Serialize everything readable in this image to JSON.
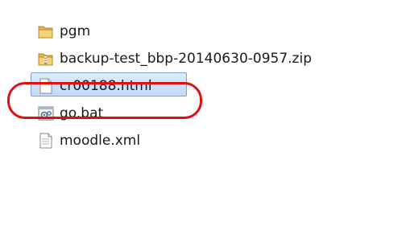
{
  "files": [
    {
      "name": "pgm",
      "icon": "folder-icon"
    },
    {
      "name": "backup-test_bbp-20140630-0957.zip",
      "icon": "zip-folder-icon"
    },
    {
      "name": "cr00188.html",
      "icon": "html-file-icon"
    },
    {
      "name": "go.bat",
      "icon": "batch-file-icon"
    },
    {
      "name": "moodle.xml",
      "icon": "xml-file-icon"
    }
  ],
  "selected_file": "cr00188.html",
  "colors": {
    "highlight_ring": "#e01010",
    "selection_border": "#7da2ce",
    "selection_fill": "#c1dbfc",
    "folder": "#e8b64a"
  }
}
